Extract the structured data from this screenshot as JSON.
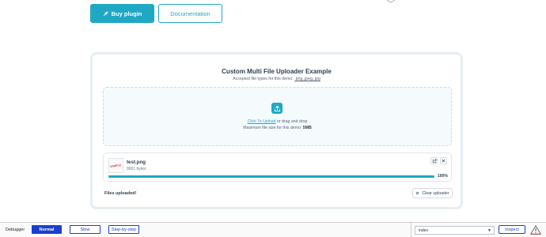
{
  "hero": {
    "buy_label": "Buy plugin",
    "buy_icon": "rocket-icon",
    "docs_label": "Documentation"
  },
  "uploader": {
    "title": "Custom Multi File Uploader Example",
    "accepted_prefix": "Accepted file types for this demo: ",
    "accepted_types": ".png,.jpeg,.jpg",
    "dropzone": {
      "icon": "upload-icon",
      "click_link": "Click To Upload",
      "drag_text": " or drag and drop",
      "max_prefix": "Maximum file size for this demo: ",
      "max_size": "5MB"
    },
    "files": [
      {
        "name": "test.png",
        "size": "9001 bytes",
        "thumb_text": "SAMPLE",
        "progress": 1.0,
        "progress_label": "100%"
      }
    ],
    "status": "Files uploaded!",
    "clear_label": "Clear uploader"
  },
  "debugger": {
    "label": "Debugger",
    "modes": [
      "Normal",
      "Slow",
      "Step-by-step"
    ],
    "active_mode": "Normal",
    "select_value": "index",
    "inspect_label": "Inspect",
    "warning_icon": "warning-icon"
  },
  "colors": {
    "accent": "#1ea8c4",
    "debugger_blue": "#1a3fcf",
    "warning": "#d6453a"
  }
}
